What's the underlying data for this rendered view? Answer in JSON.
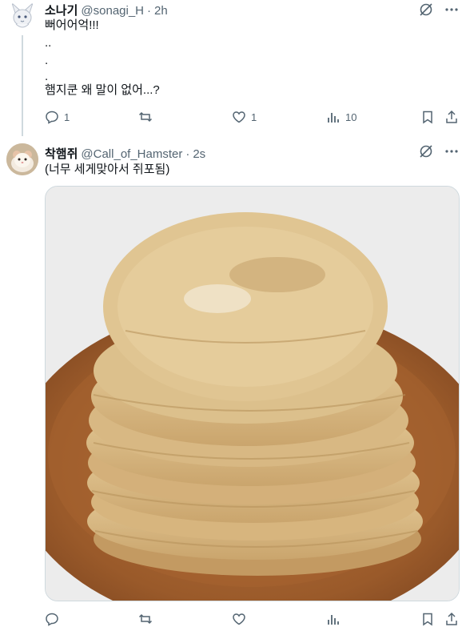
{
  "tweets": [
    {
      "display_name": "소나기",
      "handle": "@sonagi_H",
      "separator": "·",
      "time": "2h",
      "lines": [
        "뻐어어억!!!",
        "..",
        ".",
        ".",
        "햄지쿤 왜 말이 없어...?"
      ],
      "reply_count": "1",
      "like_count": "1",
      "view_count": "10"
    },
    {
      "display_name": "착햄쥐",
      "handle": "@Call_of_Hamster",
      "separator": "·",
      "time": "2s",
      "lines": [
        "(너무 세게맞아서 쥐포됨)"
      ],
      "media_description": "dried filefish stack on wooden plate"
    }
  ],
  "icons": {
    "grok": "grok-icon",
    "more": "more-icon",
    "reply": "reply-icon",
    "retweet": "retweet-icon",
    "like": "heart-icon",
    "views": "views-icon",
    "bookmark": "bookmark-icon",
    "share": "share-icon"
  },
  "colors": {
    "text": "#0f1419",
    "secondary": "#536471",
    "thread_line": "#cfd9de"
  }
}
